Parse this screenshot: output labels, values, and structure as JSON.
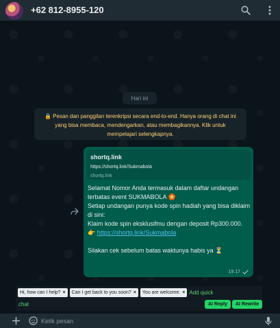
{
  "header": {
    "contact_name": "+62 812-8955-120",
    "icons": [
      "search-icon",
      "more-vert-icon"
    ]
  },
  "chat": {
    "date_chip": "Hari ini",
    "encryption_notice": "Pesan dan panggilan terenkripsi secara end-to-end. Hanya orang di chat ini yang bisa membaca, mendengarkan, atau membagikannya. Klik untuk mempelajari selengkapnya.",
    "message": {
      "link_preview": {
        "title": "shortq.link",
        "url": "https://shortq.link/Sukmabola",
        "domain": "shortq.link"
      },
      "text_intro": "Selamat Nomor Anda termasuk dalam daftar undangan terbatas event SUKMABOLA 🏵️\nSetiap undangan punya kode spin hadiah yang bisa diklaim di sini:\nKlaim kode spin eksklusifmu dengan deposit Rp300.000.\n👉 ",
      "link_text": "https://shortq.link/Sukmabola",
      "text_outro": "\n\nSilakan cek sebelum batas waktunya habis ya ⏳",
      "time": "19.17",
      "status": "sent-check"
    }
  },
  "quick_chat": {
    "chips": [
      "Hi, how can I help?",
      "Can I get back to you soon?",
      "You are welcome."
    ],
    "remove_symbol": "×",
    "add_label_part1": "Add quick",
    "add_label_part2": "chat",
    "ai_reply": "AI Reply",
    "ai_rewrite": "AI Rewrite"
  },
  "footer": {
    "placeholder": "Ketik pesan",
    "icons": [
      "plus-icon",
      "sticker-icon",
      "microphone-icon"
    ]
  },
  "colors": {
    "header_bg": "#202c33",
    "chat_bg": "#0b141a",
    "outgoing_bubble": "#005c4b",
    "encryption_text": "#ffd279",
    "link": "#53bdeb",
    "accent_green": "#25d366"
  }
}
